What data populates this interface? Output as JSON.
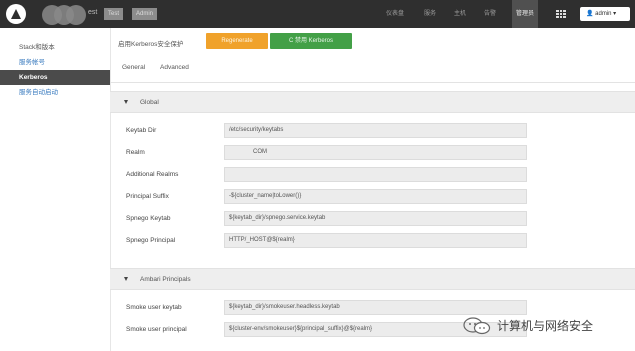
{
  "topbar": {
    "brand_tail": "est",
    "badges": [
      "Test",
      "Admin"
    ],
    "nav": [
      "仪表盘",
      "服务",
      "主机",
      "告警",
      "管理员"
    ],
    "active_nav": "管理员",
    "grid_icon": "grid-icon",
    "user_icon": "user-icon",
    "user_label": "admin"
  },
  "sidebar": {
    "items": [
      {
        "label": "Stack和版本"
      },
      {
        "label": "服务帐号"
      },
      {
        "label": "Kerberos",
        "active": true
      },
      {
        "label": "服务自动启动"
      }
    ]
  },
  "main": {
    "breadcrumb": "启用Kerberos安全保护",
    "btn_regenerate": "Regenerate",
    "btn_disable": "C 禁用 Kerberos",
    "tabs": [
      "General",
      "Advanced"
    ],
    "sections": [
      {
        "title": "Global",
        "rows": [
          {
            "label": "Keytab Dir",
            "value": "/etc/security/keytabs"
          },
          {
            "label": "Realm",
            "value": "COM"
          },
          {
            "label": "Additional Realms",
            "value": ""
          },
          {
            "label": "Principal Suffix",
            "value": "-${cluster_name|toLower()}"
          },
          {
            "label": "Spnego Keytab",
            "value": "${keytab_dir}/spnego.service.keytab"
          },
          {
            "label": "Spnego Principal",
            "value": "HTTP/_HOST@${realm}"
          }
        ]
      },
      {
        "title": "Ambari Principals",
        "rows": [
          {
            "label": "Smoke user keytab",
            "value": "${keytab_dir}/smokeuser.headless.keytab"
          },
          {
            "label": "Smoke user principal",
            "value": "${cluster-env/smokeuser}${principal_suffix}@${realm}"
          }
        ]
      }
    ]
  },
  "watermark": {
    "text": "计算机与网络安全",
    "icon": "wechat-icon"
  }
}
